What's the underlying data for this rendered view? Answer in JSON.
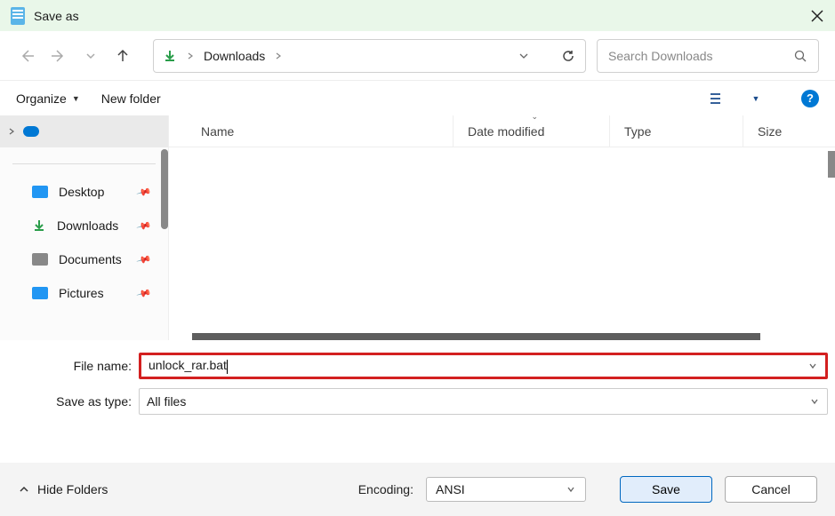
{
  "title": "Save as",
  "breadcrumb": {
    "location": "Downloads"
  },
  "search": {
    "placeholder": "Search Downloads"
  },
  "toolbar": {
    "organize": "Organize",
    "new_folder": "New folder"
  },
  "sidebar": {
    "items": [
      {
        "label": "Desktop"
      },
      {
        "label": "Downloads"
      },
      {
        "label": "Documents"
      },
      {
        "label": "Pictures"
      }
    ]
  },
  "columns": {
    "name": "Name",
    "date": "Date modified",
    "type": "Type",
    "size": "Size"
  },
  "form": {
    "filename_label": "File name:",
    "filename_value": "unlock_rar.bat",
    "savetype_label": "Save as type:",
    "savetype_value": "All files"
  },
  "footer": {
    "hide_folders": "Hide Folders",
    "encoding_label": "Encoding:",
    "encoding_value": "ANSI",
    "save": "Save",
    "cancel": "Cancel"
  }
}
